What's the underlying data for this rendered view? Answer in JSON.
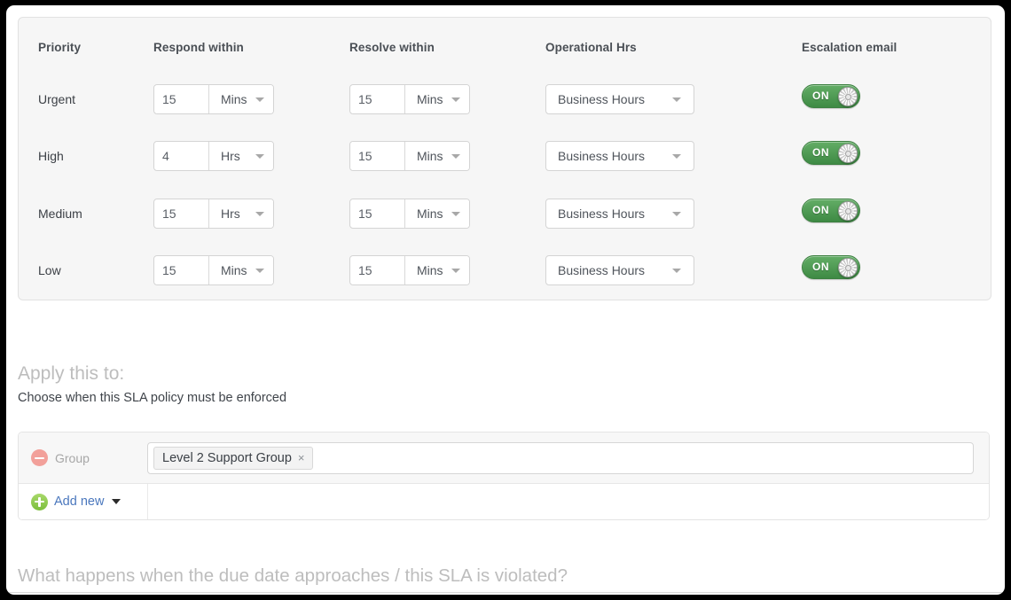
{
  "matrix": {
    "headers": {
      "priority": "Priority",
      "respond": "Respond within",
      "resolve": "Resolve within",
      "operational": "Operational Hrs",
      "escalation": "Escalation email"
    },
    "rows": [
      {
        "priority": "Urgent",
        "respond_value": "15",
        "respond_unit": "Mins",
        "resolve_value": "15",
        "resolve_unit": "Mins",
        "operational_hours": "Business Hours",
        "escalation_state": "ON"
      },
      {
        "priority": "High",
        "respond_value": "4",
        "respond_unit": "Hrs",
        "resolve_value": "15",
        "resolve_unit": "Mins",
        "operational_hours": "Business Hours",
        "escalation_state": "ON"
      },
      {
        "priority": "Medium",
        "respond_value": "15",
        "respond_unit": "Hrs",
        "resolve_value": "15",
        "resolve_unit": "Mins",
        "operational_hours": "Business Hours",
        "escalation_state": "ON"
      },
      {
        "priority": "Low",
        "respond_value": "15",
        "respond_unit": "Mins",
        "resolve_value": "15",
        "resolve_unit": "Mins",
        "operational_hours": "Business Hours",
        "escalation_state": "ON"
      }
    ]
  },
  "apply": {
    "title": "Apply this to:",
    "subtitle": "Choose when this SLA policy must be enforced",
    "condition_label": "Group",
    "chip_label": "Level 2 Support Group",
    "chip_remove": "×",
    "add_new_label": "Add new"
  },
  "bottom": {
    "heading": "What happens when the due date approaches / this SLA is violated?"
  },
  "colors": {
    "toggle_on": "#4a9e50",
    "link": "#4a77bd",
    "remove": "#f2a09a",
    "add": "#7cbe3d",
    "panel_bg": "#f6f6f6"
  }
}
